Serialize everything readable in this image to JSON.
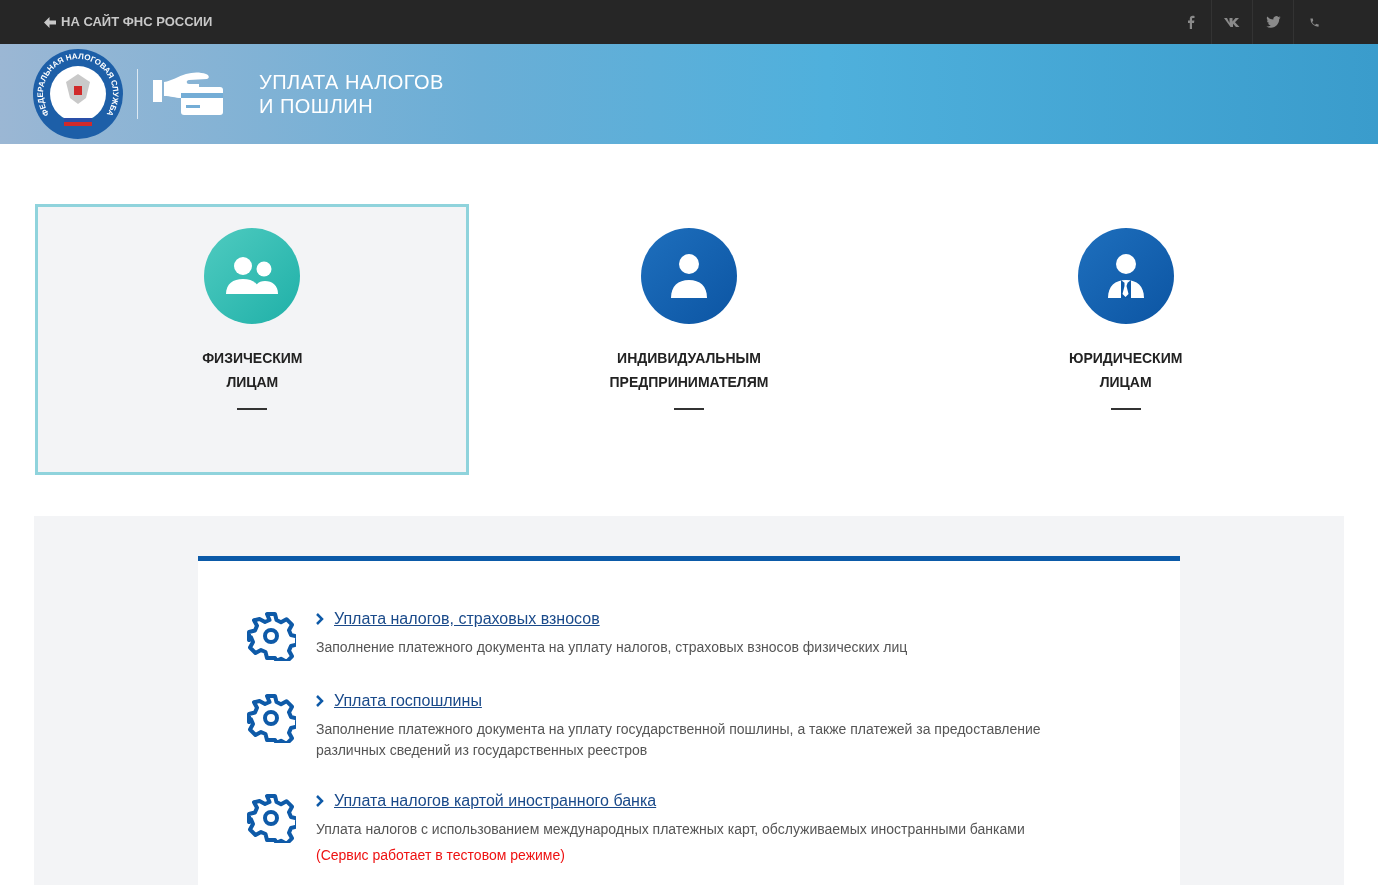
{
  "top_bar": {
    "back_link": "НА САЙТ ФНС РОССИИ",
    "social": [
      {
        "kind": "facebook"
      },
      {
        "kind": "vk"
      },
      {
        "kind": "twitter"
      },
      {
        "kind": "phone"
      }
    ]
  },
  "banner": {
    "logo_text": "ФЕДЕРАЛЬНАЯ НАЛОГОВАЯ СЛУЖБА",
    "title_lines": [
      "УПЛАТА НАЛОГОВ",
      "И ПОШЛИН"
    ]
  },
  "categories": [
    {
      "kind": "group",
      "lines": [
        "ФИЗИЧЕСКИМ",
        "ЛИЦАМ"
      ],
      "selected": true
    },
    {
      "kind": "person",
      "lines": [
        "ИНДИВИДУАЛЬНЫМ",
        "ПРЕДПРИНИМАТЕЛЯМ"
      ],
      "selected": false
    },
    {
      "kind": "business",
      "lines": [
        "ЮРИДИЧЕСКИМ",
        "ЛИЦАМ"
      ],
      "selected": false
    }
  ],
  "services": [
    {
      "title": "Уплата налогов, страховых взносов",
      "description": "Заполнение платежного документа на уплату налогов, страховых взносов физических лиц"
    },
    {
      "title": "Уплата госпошлины",
      "description": "Заполнение платежного документа на уплату государственной пошлины, а также платежей за предоставление различных сведений из государственных реестров"
    },
    {
      "title": "Уплата налогов картой иностранного банка",
      "description": "Уплата налогов с использованием международных платежных карт, обслуживаемых иностранными банками",
      "note": "(Сервис работает в тестовом режиме)"
    }
  ]
}
